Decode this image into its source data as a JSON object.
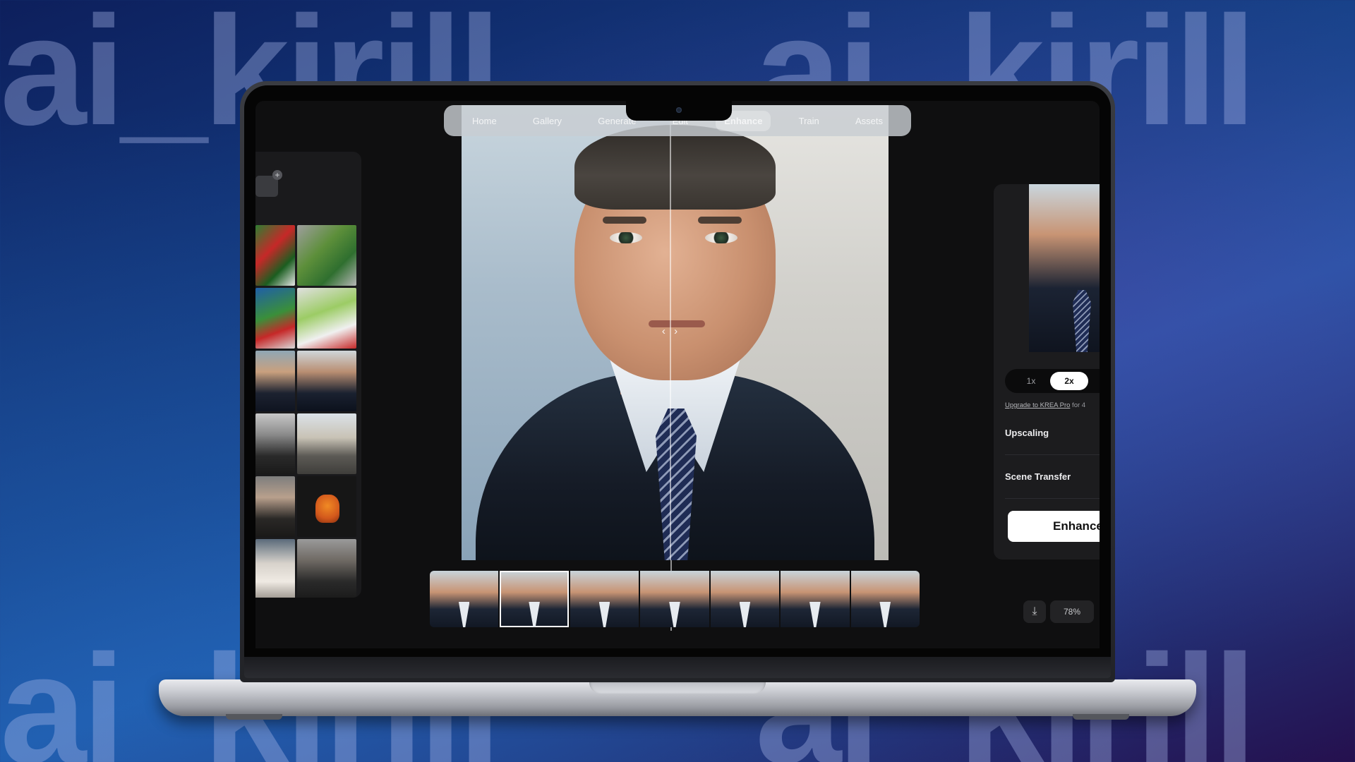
{
  "watermark": {
    "text": "ai_kirill"
  },
  "nav": {
    "items": [
      {
        "label": "Home",
        "active": false
      },
      {
        "label": "Gallery",
        "active": false
      },
      {
        "label": "Generate",
        "active": false
      },
      {
        "label": "Edit",
        "active": false
      },
      {
        "label": "Enhance",
        "active": true
      },
      {
        "label": "Train",
        "active": false
      },
      {
        "label": "Assets",
        "active": false
      }
    ]
  },
  "sidebar": {
    "thumbnails": [
      "grinch-photo",
      "grinch-photo",
      "christmas-photo",
      "christmas-photo",
      "portrait-color",
      "portrait-color",
      "portrait-bw",
      "ship-photo",
      "portrait-mustache",
      "dog-illustration",
      "portrait-beard",
      "portrait-bw"
    ]
  },
  "compare": {
    "handle": "‹ ›"
  },
  "filmstrip": {
    "count": 7,
    "selected_index": 1
  },
  "panel": {
    "scale_options": [
      "1x",
      "2x"
    ],
    "scale_selected": "2x",
    "upgrade_link_text": "Upgrade to KREA Pro",
    "upgrade_suffix": " for 4",
    "upscaling_label": "Upscaling",
    "scene_transfer_label": "Scene Transfer",
    "enhance_button": "Enhance"
  },
  "footer": {
    "download_icon": "download-icon",
    "zoom_level": "78%"
  },
  "colors": {
    "accent": "#ffffff",
    "background": "#0f0f10",
    "panel": "#1c1c1e"
  }
}
